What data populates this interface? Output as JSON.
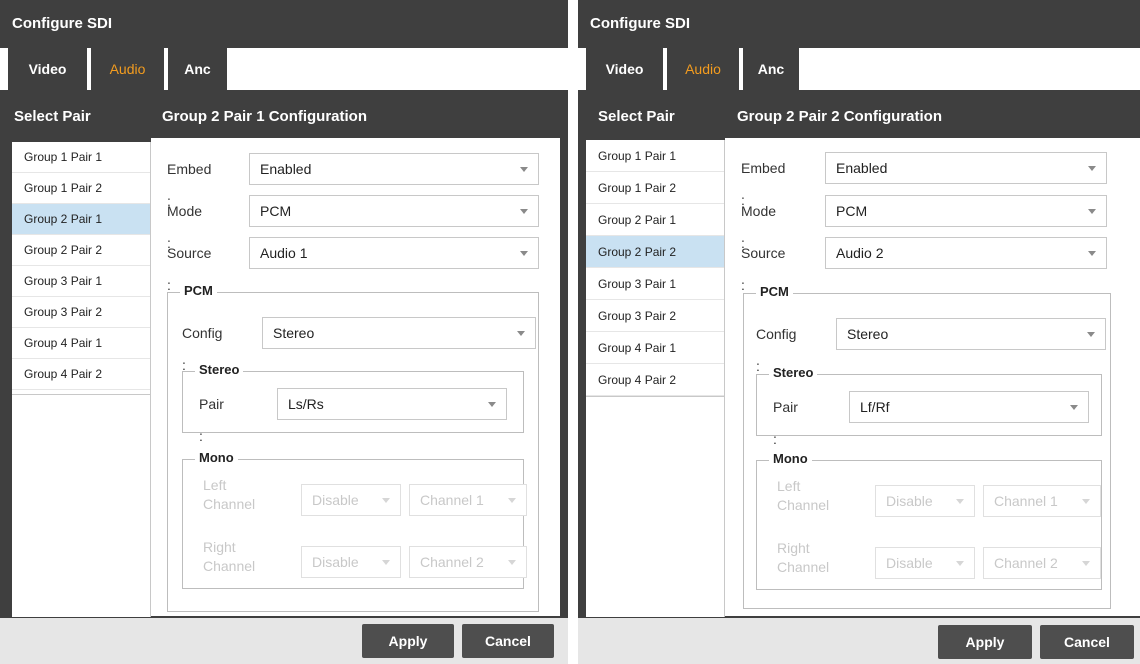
{
  "panels": [
    {
      "title": "Configure SDI",
      "tabs": [
        {
          "label": "Video"
        },
        {
          "label": "Audio"
        },
        {
          "label": "Anc"
        }
      ],
      "select_pair_header": "Select Pair",
      "config_title": "Group 2 Pair 1 Configuration",
      "pairs": [
        "Group 1 Pair 1",
        "Group 1 Pair 2",
        "Group 2 Pair 1",
        "Group 2 Pair 2",
        "Group 3 Pair 1",
        "Group 3 Pair 2",
        "Group 4 Pair 1",
        "Group 4 Pair 2"
      ],
      "selected_pair": "Group 2 Pair 1",
      "embed": {
        "label": "Embed :",
        "value": "Enabled"
      },
      "mode": {
        "label": "Mode :",
        "value": "PCM"
      },
      "source": {
        "label": "Source :",
        "value": "Audio 1"
      },
      "pcm": {
        "legend": "PCM",
        "config": {
          "label": "Config :",
          "value": "Stereo"
        },
        "stereo": {
          "legend": "Stereo",
          "pair_label": "Pair :",
          "pair_value": "Ls/Rs"
        },
        "mono": {
          "legend": "Mono",
          "left": {
            "label_line1": "Left",
            "label_line2": "Channel",
            "enable": "Disable",
            "channel": "Channel 1"
          },
          "right": {
            "label_line1": "Right",
            "label_line2": "Channel",
            "enable": "Disable",
            "channel": "Channel 2"
          }
        }
      },
      "apply_label": "Apply",
      "cancel_label": "Cancel"
    },
    {
      "title": "Configure SDI",
      "tabs": [
        {
          "label": "Video"
        },
        {
          "label": "Audio"
        },
        {
          "label": "Anc"
        }
      ],
      "select_pair_header": "Select Pair",
      "config_title": "Group 2 Pair 2 Configuration",
      "pairs": [
        "Group 1 Pair 1",
        "Group 1 Pair 2",
        "Group 2 Pair 1",
        "Group 2 Pair 2",
        "Group 3 Pair 1",
        "Group 3 Pair 2",
        "Group 4 Pair 1",
        "Group 4 Pair 2"
      ],
      "selected_pair": "Group 2 Pair 2",
      "embed": {
        "label": "Embed :",
        "value": "Enabled"
      },
      "mode": {
        "label": "Mode :",
        "value": "PCM"
      },
      "source": {
        "label": "Source :",
        "value": "Audio 2"
      },
      "pcm": {
        "legend": "PCM",
        "config": {
          "label": "Config :",
          "value": "Stereo"
        },
        "stereo": {
          "legend": "Stereo",
          "pair_label": "Pair :",
          "pair_value": "Lf/Rf"
        },
        "mono": {
          "legend": "Mono",
          "left": {
            "label_line1": "Left",
            "label_line2": "Channel",
            "enable": "Disable",
            "channel": "Channel 1"
          },
          "right": {
            "label_line1": "Right",
            "label_line2": "Channel",
            "enable": "Disable",
            "channel": "Channel 2"
          }
        }
      },
      "apply_label": "Apply",
      "cancel_label": "Cancel"
    }
  ],
  "colors": {
    "dark": "#3f3f3f",
    "active_tab": "#f39c1f",
    "selected_row": "#c9e1f2",
    "button": "#4e4e4e",
    "footer": "#e6e6e6"
  }
}
